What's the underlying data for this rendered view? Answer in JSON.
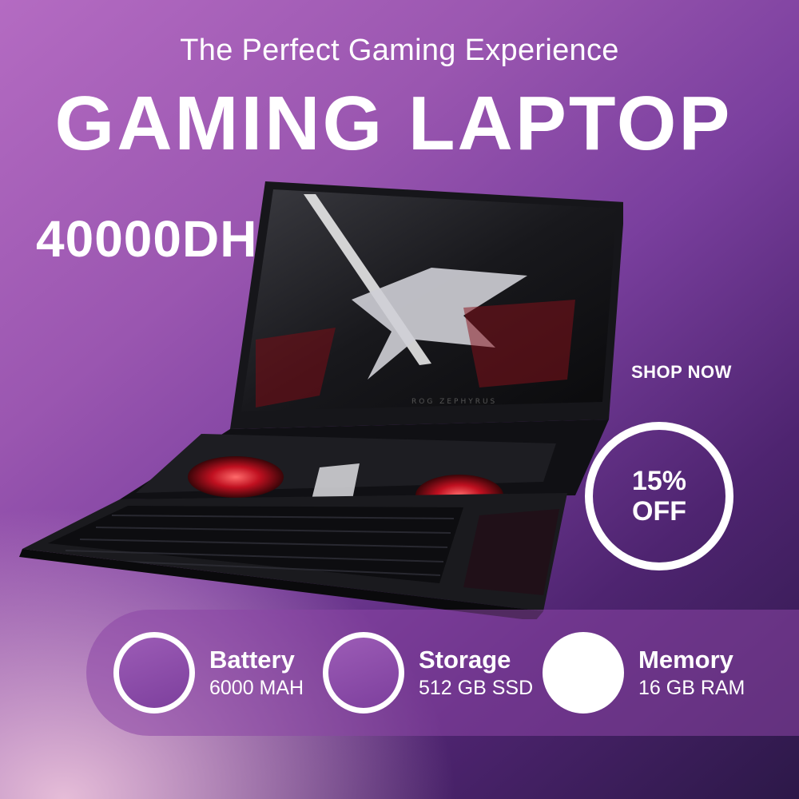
{
  "hero": {
    "tagline": "The Perfect Gaming Experience",
    "title": "GAMING LAPTOP",
    "price": "40000DH"
  },
  "promo": {
    "shop_label": "SHOP NOW",
    "discount_line1": "15%",
    "discount_line2": "OFF"
  },
  "product_image": {
    "screen_brand_text": "ROG ZEPHYRUS",
    "accent_color": "#e0192b"
  },
  "features": [
    {
      "name": "Battery",
      "value": "6000 MAH",
      "icon": "battery-icon"
    },
    {
      "name": "Storage",
      "value": "512 GB SSD",
      "icon": "storage-icon"
    },
    {
      "name": "Memory",
      "value": "16 GB RAM",
      "icon": "memory-icon"
    }
  ],
  "colors": {
    "background_light": "#ecc4dc",
    "background_mid": "#9a56b0",
    "background_dark": "#2c1848",
    "text": "#ffffff"
  }
}
